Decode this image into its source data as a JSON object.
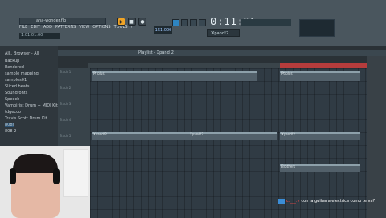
{
  "window": {
    "title": "ana-wonder.flp",
    "clock": "1:01:01:00"
  },
  "menu": [
    "FILE",
    "EDIT",
    "ADD",
    "PATTERNS",
    "VIEW",
    "OPTIONS",
    "TOOLS",
    "?"
  ],
  "transport": {
    "play_icon": "play-icon",
    "stop_icon": "stop-icon",
    "record_icon": "record-icon",
    "tempo": "161.000",
    "time_display": "0:11:35"
  },
  "pattern_selector": {
    "value": "Xpand!2"
  },
  "browser": {
    "items": [
      {
        "label": "All.. Browser - All"
      },
      {
        "label": "Backup"
      },
      {
        "label": "Rendered"
      },
      {
        "label": "sample mapping"
      },
      {
        "label": "samples01"
      },
      {
        "label": "Sliced beats"
      },
      {
        "label": "Soundfonts"
      },
      {
        "label": "Speech"
      },
      {
        "label": "Vampirist Drum + MIDI Kit"
      },
      {
        "label": "tdgecco"
      },
      {
        "label": "Travis Scott Drum Kit"
      },
      {
        "label": "808s"
      },
      {
        "label": "808 2"
      }
    ]
  },
  "playlist": {
    "title": "Playlist - Xpand!2",
    "tracks": [
      "Track 1",
      "Track 2",
      "Track 3",
      "Track 4",
      "Track 5",
      "Track 6",
      "Track 7",
      "Track 8"
    ],
    "ruler": [
      "1",
      "3",
      "5",
      "7",
      "9",
      "11",
      "13",
      "15",
      "17"
    ],
    "clip_labels": [
      "Pt plus",
      "Pt plus",
      "Pt plus",
      "Pt plus",
      "Xpand!2",
      "Xpand!2",
      "Xpand!2",
      "Xpand!2",
      "Brothers"
    ]
  },
  "chat": {
    "username": "c.___.v",
    "message": "con la guitarra electrica como te va?"
  },
  "colors": {
    "accent": "#f0a426",
    "blue": "#2e85c2",
    "red": "#b63c3c"
  }
}
